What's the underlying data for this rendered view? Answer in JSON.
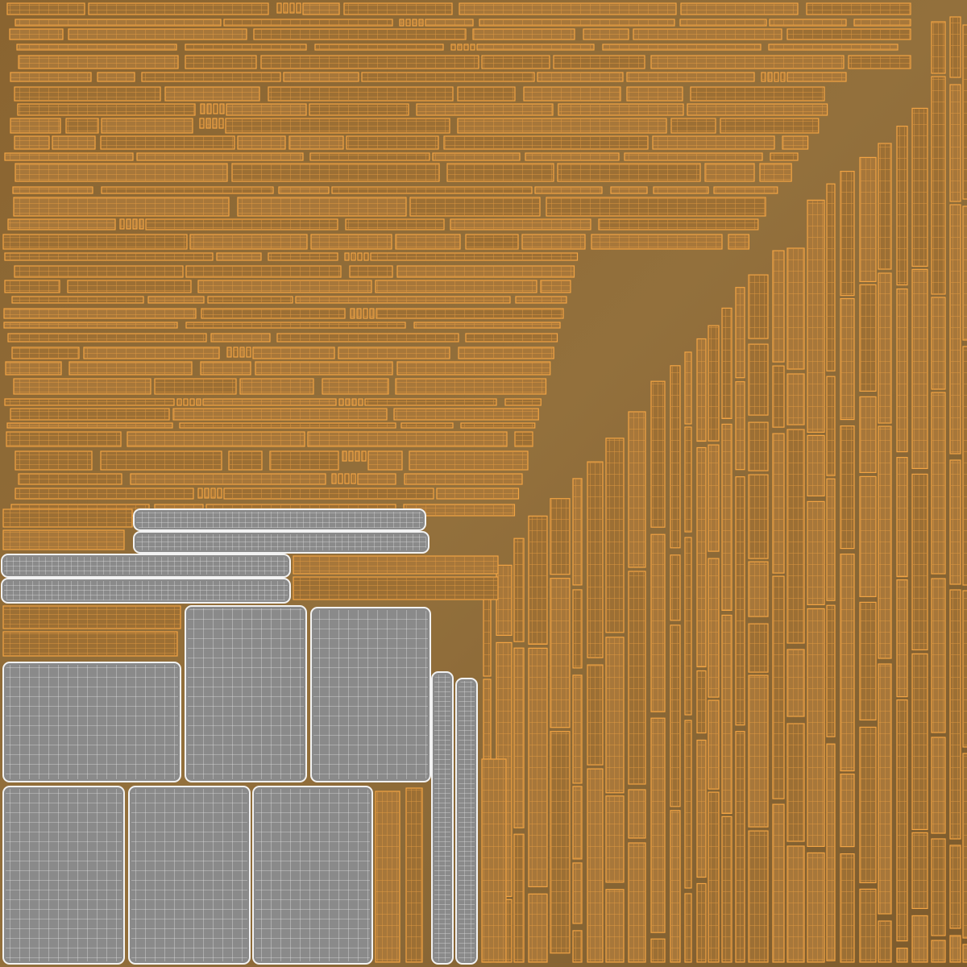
{
  "texture": {
    "kind": "uv-wireframe-texture-atlas",
    "colors": {
      "background": "#8f6a35",
      "background_dark": "#6e4f26",
      "wood_fill": "#9c6f34",
      "wood_fill_alt": "#a7773a",
      "wireframe_orange": "#f2a444",
      "wireframe_orange_dim": "#d88c34",
      "fabric_fill": "#8a8a8a",
      "fabric_fill_alt": "#9a9a9a",
      "wireframe_white": "#f2f2f2",
      "shadow": "#4a3418"
    }
  }
}
